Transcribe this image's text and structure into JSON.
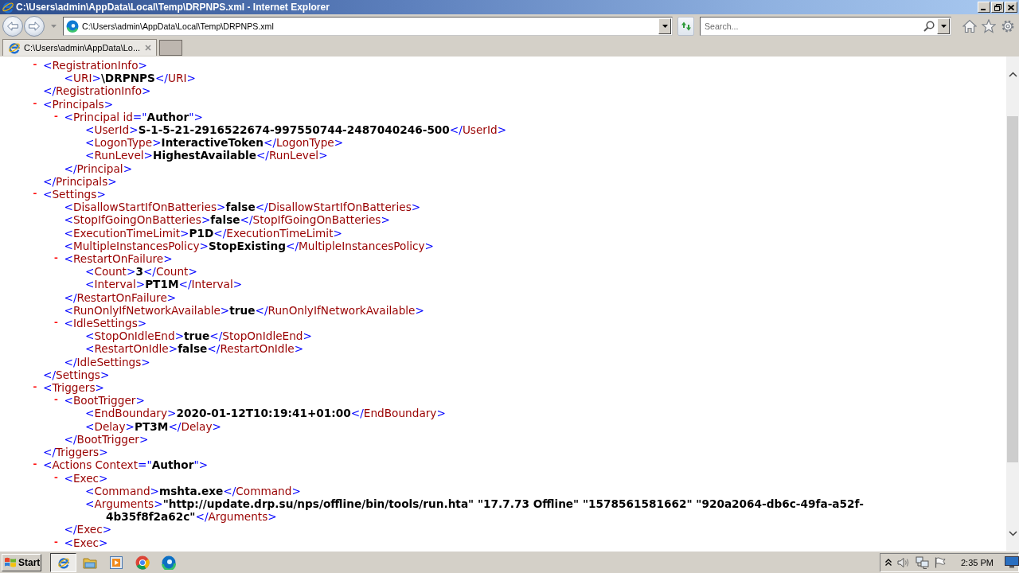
{
  "window": {
    "title": "C:\\Users\\admin\\AppData\\Local\\Temp\\DRPNPS.xml - Internet Explorer"
  },
  "address_bar": {
    "value": "C:\\Users\\admin\\AppData\\Local\\Temp\\DRPNPS.xml"
  },
  "search": {
    "placeholder": "Search..."
  },
  "tabs": [
    {
      "label": "C:\\Users\\admin\\AppData\\Lo...",
      "selected": true
    }
  ],
  "document": {
    "nodes": [
      {
        "toggle": "-",
        "open_tag": "<RegistrationInfo>",
        "children": [
          {
            "open_tag": "<URI>",
            "value": "\\DRPNPS",
            "close_tag": "</URI>"
          }
        ],
        "close_tag": "</RegistrationInfo>"
      },
      {
        "toggle": "-",
        "open_tag": "<Principals>",
        "children": [
          {
            "toggle": "-",
            "open_tag": "<Principal id=\"Author\">",
            "children": [
              {
                "open_tag": "<UserId>",
                "value": "S-1-5-21-2916522674-997550744-2487040246-500",
                "close_tag": "</UserId>"
              },
              {
                "open_tag": "<LogonType>",
                "value": "InteractiveToken",
                "close_tag": "</LogonType>"
              },
              {
                "open_tag": "<RunLevel>",
                "value": "HighestAvailable",
                "close_tag": "</RunLevel>"
              }
            ],
            "close_tag": "</Principal>"
          }
        ],
        "close_tag": "</Principals>"
      },
      {
        "toggle": "-",
        "open_tag": "<Settings>",
        "children": [
          {
            "open_tag": "<DisallowStartIfOnBatteries>",
            "value": "false",
            "close_tag": "</DisallowStartIfOnBatteries>"
          },
          {
            "open_tag": "<StopIfGoingOnBatteries>",
            "value": "false",
            "close_tag": "</StopIfGoingOnBatteries>"
          },
          {
            "open_tag": "<ExecutionTimeLimit>",
            "value": "P1D",
            "close_tag": "</ExecutionTimeLimit>"
          },
          {
            "open_tag": "<MultipleInstancesPolicy>",
            "value": "StopExisting",
            "close_tag": "</MultipleInstancesPolicy>"
          },
          {
            "toggle": "-",
            "open_tag": "<RestartOnFailure>",
            "children": [
              {
                "open_tag": "<Count>",
                "value": "3",
                "close_tag": "</Count>"
              },
              {
                "open_tag": "<Interval>",
                "value": "PT1M",
                "close_tag": "</Interval>"
              }
            ],
            "close_tag": "</RestartOnFailure>"
          },
          {
            "open_tag": "<RunOnlyIfNetworkAvailable>",
            "value": "true",
            "close_tag": "</RunOnlyIfNetworkAvailable>"
          },
          {
            "toggle": "-",
            "open_tag": "<IdleSettings>",
            "children": [
              {
                "open_tag": "<StopOnIdleEnd>",
                "value": "true",
                "close_tag": "</StopOnIdleEnd>"
              },
              {
                "open_tag": "<RestartOnIdle>",
                "value": "false",
                "close_tag": "</RestartOnIdle>"
              }
            ],
            "close_tag": "</IdleSettings>"
          }
        ],
        "close_tag": "</Settings>"
      },
      {
        "toggle": "-",
        "open_tag": "<Triggers>",
        "children": [
          {
            "toggle": "-",
            "open_tag": "<BootTrigger>",
            "children": [
              {
                "open_tag": "<EndBoundary>",
                "value": "2020-01-12T10:19:41+01:00",
                "close_tag": "</EndBoundary>"
              },
              {
                "open_tag": "<Delay>",
                "value": "PT3M",
                "close_tag": "</Delay>"
              }
            ],
            "close_tag": "</BootTrigger>"
          }
        ],
        "close_tag": "</Triggers>"
      },
      {
        "toggle": "-",
        "open_tag": "<Actions Context=\"Author\">",
        "children": [
          {
            "toggle": "-",
            "open_tag": "<Exec>",
            "children": [
              {
                "open_tag": "<Command>",
                "value": "mshta.exe",
                "close_tag": "</Command>"
              },
              {
                "open_tag": "<Arguments>",
                "value": "\"http://update.drp.su/nps/offline/bin/tools/run.hta\" \"17.7.73 Offline\" \"1578561581662\" \"920a2064-db6c-49fa-a52f-4b35f8f2a62c\"",
                "close_tag": "</Arguments>"
              }
            ],
            "close_tag": "</Exec>"
          },
          {
            "toggle": "-",
            "open_tag": "<Exec>"
          }
        ]
      }
    ]
  },
  "taskbar": {
    "start_label": "Start",
    "pinned": [
      {
        "selected": true
      },
      {
        "selected": false
      },
      {
        "selected": false
      },
      {
        "selected": false
      },
      {
        "selected": false
      }
    ],
    "clock": "2:35 PM"
  }
}
